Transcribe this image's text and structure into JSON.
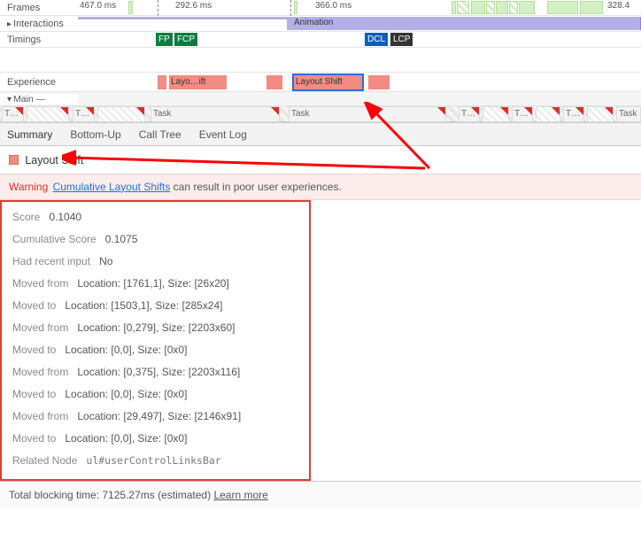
{
  "tracks": {
    "frames_label": "Frames",
    "interactions_label": "Interactions",
    "timings_label": "Timings",
    "experience_label": "Experience",
    "main_label": "Main —",
    "frame_times": [
      "467.0 ms",
      "292.6 ms",
      "366.0 ms",
      "328.4"
    ],
    "animation_label": "Animation",
    "timings": {
      "fp": "FP",
      "fcp": "FCP",
      "dcl": "DCL",
      "lcp": "LCP"
    },
    "exp1": "Layo…ift",
    "exp2": "Layout Shift",
    "task_short": "T…",
    "task_label": "Task"
  },
  "tabs": {
    "summary": "Summary",
    "bottomup": "Bottom-Up",
    "calltree": "Call Tree",
    "eventlog": "Event Log"
  },
  "summary": {
    "title": "Layout Shift",
    "warn_label": "Warning",
    "warn_link": "Cumulative Layout Shifts",
    "warn_text": "can result in poor user experiences."
  },
  "details": [
    {
      "k": "Score",
      "v": "0.1040"
    },
    {
      "k": "Cumulative Score",
      "v": "0.1075"
    },
    {
      "k": "Had recent input",
      "v": "No"
    },
    {
      "k": "Moved from",
      "v": "Location: [1761,1], Size: [26x20]"
    },
    {
      "k": "Moved to",
      "v": "Location: [1503,1], Size: [285x24]"
    },
    {
      "k": "Moved from",
      "v": "Location: [0,279], Size: [2203x60]"
    },
    {
      "k": "Moved to",
      "v": "Location: [0,0], Size: [0x0]"
    },
    {
      "k": "Moved from",
      "v": "Location: [0,375], Size: [2203x116]"
    },
    {
      "k": "Moved to",
      "v": "Location: [0,0], Size: [0x0]"
    },
    {
      "k": "Moved from",
      "v": "Location: [29,497], Size: [2146x91]"
    },
    {
      "k": "Moved to",
      "v": "Location: [0,0], Size: [0x0]"
    }
  ],
  "related": {
    "k": "Related Node",
    "v": "ul#userControlLinksBar"
  },
  "footer": {
    "text_a": "Total blocking time: 7125.27ms (estimated)",
    "link": "Learn more"
  }
}
